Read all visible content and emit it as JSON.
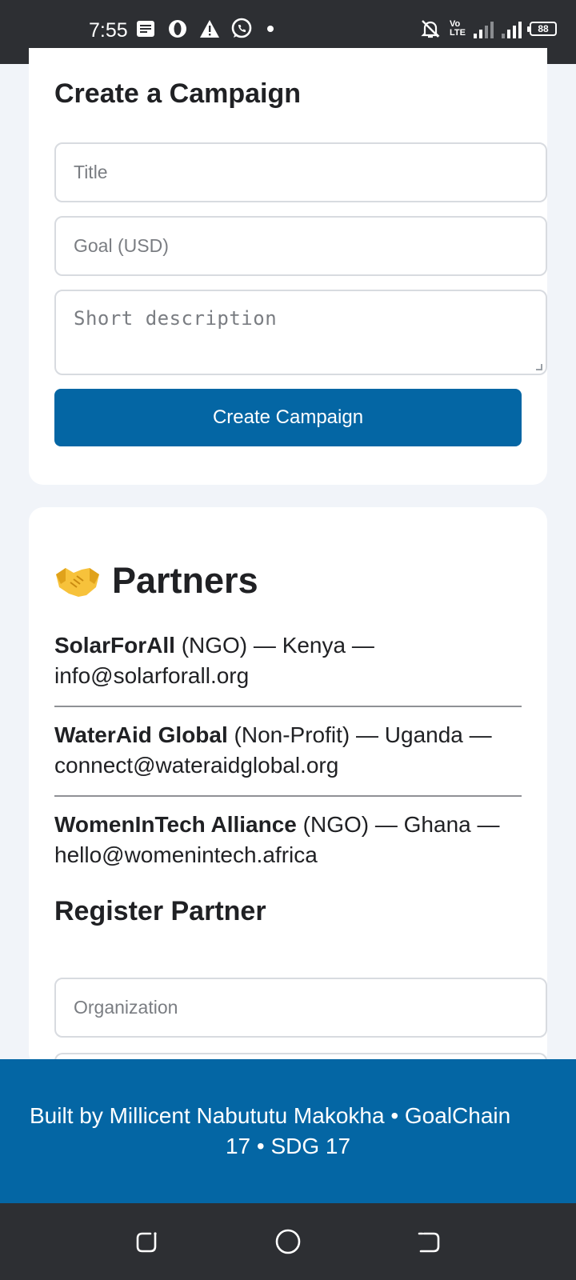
{
  "status_bar": {
    "time": "7:55",
    "network_top": "Vo",
    "network_bottom": "LTE",
    "network_gen": "4G",
    "battery": "88"
  },
  "campaign_form": {
    "heading": "Create a Campaign",
    "title_placeholder": "Title",
    "goal_placeholder": "Goal (USD)",
    "description_placeholder": "Short description",
    "submit_label": "Create Campaign"
  },
  "partners": {
    "emoji": "🤝",
    "heading": "Partners",
    "items": [
      {
        "name": "SolarForAll",
        "details": " (NGO) — Kenya — info@solarforall.org"
      },
      {
        "name": "WaterAid Global",
        "details": " (Non-Profit) — Uganda — connect@wateraidglobal.org"
      },
      {
        "name": "WomenInTech Alliance",
        "details": " (NGO) — Ghana — hello@womenintech.africa"
      }
    ],
    "register_heading": "Register Partner",
    "organization_placeholder": "Organization"
  },
  "footer": {
    "line1": "Built by Millicent Nabututu Makokha • GoalChain",
    "line2": "17 • SDG 17"
  },
  "colors": {
    "primary": "#0466a4",
    "background": "#f1f4f9",
    "system_bar": "#2d2f33"
  }
}
